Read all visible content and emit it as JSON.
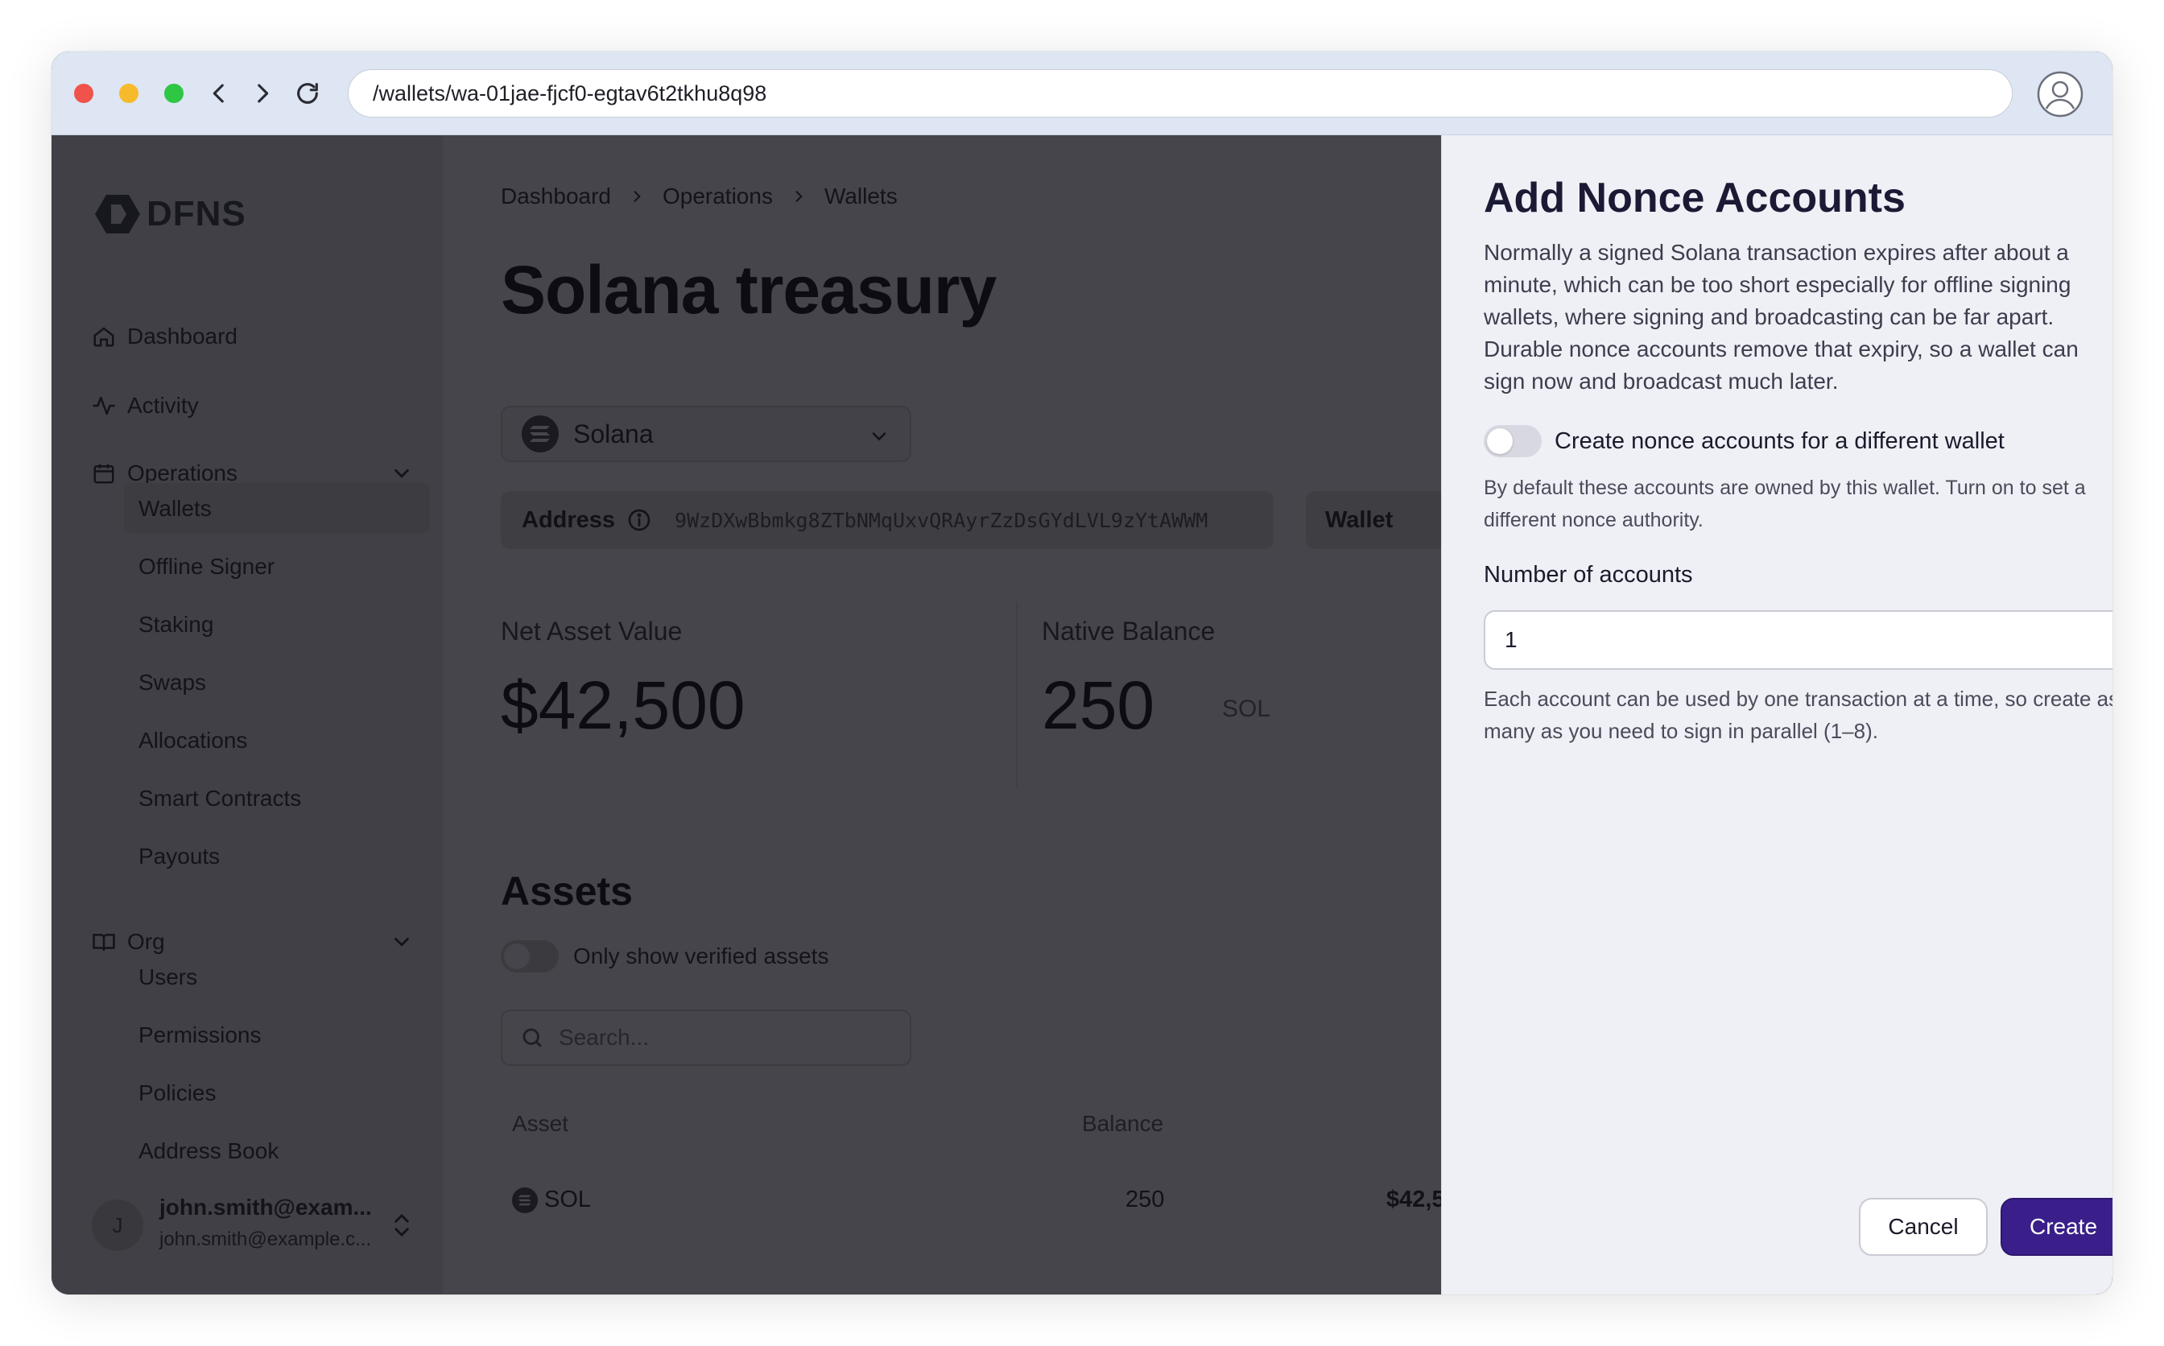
{
  "browser": {
    "url": "/wallets/wa-01jae-fjcf0-egtav6t2tkhu8q98",
    "colors": {
      "close": "#f0524c",
      "minimize": "#f7ba2b",
      "maximize": "#2ec744"
    }
  },
  "sidebar": {
    "logo_text": "DFNS",
    "nav": {
      "dashboard": "Dashboard",
      "activity": "Activity",
      "operations": "Operations",
      "org": "Org"
    },
    "operations_items": [
      "Wallets",
      "Offline Signer",
      "Staking",
      "Swaps",
      "Allocations",
      "Smart Contracts",
      "Payouts"
    ],
    "org_items": [
      "Users",
      "Permissions",
      "Policies",
      "Address Book"
    ],
    "user": {
      "initial": "J",
      "name": "john.smith@exam...",
      "email": "john.smith@example.c..."
    }
  },
  "main": {
    "breadcrumb": [
      "Dashboard",
      "Operations",
      "Wallets"
    ],
    "title": "Solana treasury",
    "network": "Solana",
    "address_label": "Address",
    "address_value": "9WzDXwBbmkg8ZTbNMqUxvQRAyrZzDsGYdLVL9zYtAWWM",
    "wallet_label": "Wallet",
    "net_asset_value_label": "Net Asset Value",
    "net_asset_value": "$42,500",
    "native_balance_label": "Native Balance",
    "native_balance": "250",
    "native_unit": "SOL",
    "assets_title": "Assets",
    "verified_toggle_label": "Only show verified assets",
    "search_placeholder": "Search...",
    "table": {
      "headers": {
        "asset": "Asset",
        "balance": "Balance"
      },
      "rows": [
        {
          "asset": "SOL",
          "balance": "250",
          "value": "$42,5"
        }
      ]
    }
  },
  "drawer": {
    "title": "Add Nonce Accounts",
    "description": "Normally a signed Solana transaction expires after about a minute, which can be too short especially for offline signing wallets, where signing and broadcasting can be far apart. Durable nonce accounts remove that expiry, so a wallet can sign now and broadcast much later.",
    "toggle_label": "Create nonce accounts for a different wallet",
    "toggle_on": false,
    "toggle_help": "By default these accounts are owned by this wallet. Turn on to set a different nonce authority.",
    "accounts_label": "Number of accounts",
    "accounts_value": "1",
    "accounts_help": "Each account can be used by one transaction at a time, so create as many as you need to sign in parallel (1–8).",
    "cancel_label": "Cancel",
    "create_label": "Create",
    "accent_color": "#3a1f8a"
  }
}
